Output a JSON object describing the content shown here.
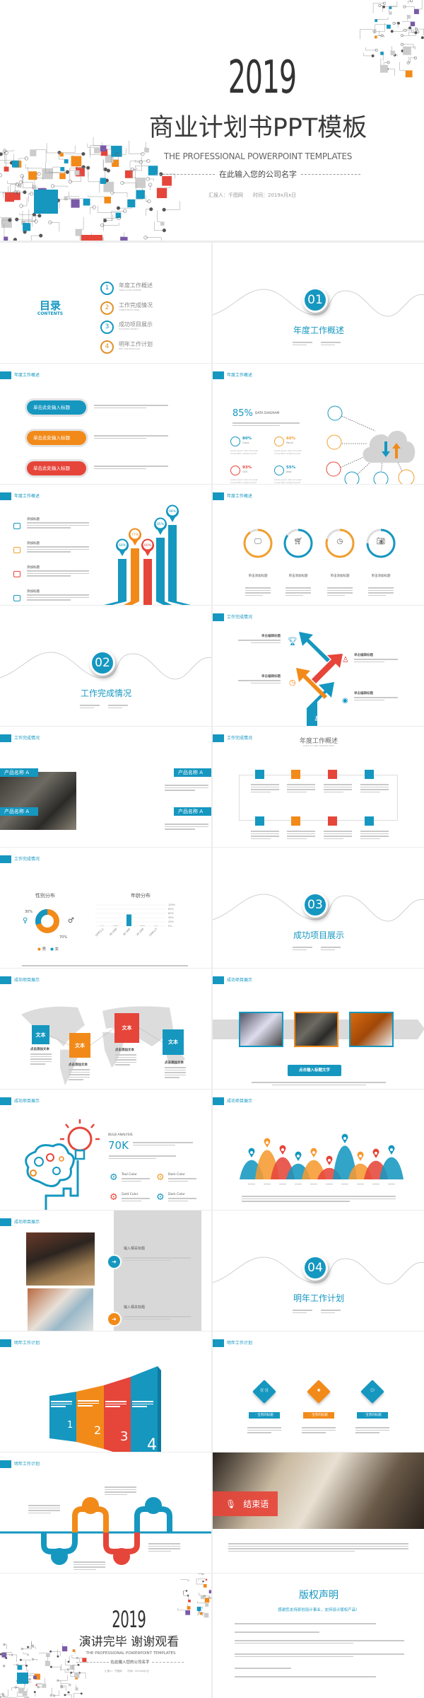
{
  "colors": {
    "teal": "#1597c0",
    "orange": "#f28a1a",
    "red": "#e6453a",
    "grey": "#cccccc"
  },
  "cover": {
    "year": "2019",
    "title": "商业计划书PPT模板",
    "subtitle_en": "THE PROFESSIONAL POWERPOINT TEMPLATES",
    "company": "在此输入您的公司名字",
    "reporter": "汇报人：千图网",
    "date": "时间：2019x月x日"
  },
  "toc": {
    "title": "目录",
    "title_en": "CONTENTS",
    "items": [
      {
        "num": "1",
        "label": "年度工作概述",
        "label_en": "ANNUAL WORK SUMMARY",
        "color": "#1597c0"
      },
      {
        "num": "2",
        "label": "工作完成情况",
        "label_en": "COMPLETION OF WORK",
        "color": "#e0922a"
      },
      {
        "num": "3",
        "label": "成功项目展示",
        "label_en": "SUCCESSFUL PROJECT",
        "color": "#1597c0"
      },
      {
        "num": "4",
        "label": "明年工作计划",
        "label_en": "NEXT YEAR WORK PLAN",
        "color": "#e0922a"
      }
    ]
  },
  "sections": [
    {
      "num": "01",
      "title": "年度工作概述"
    },
    {
      "num": "02",
      "title": "工作完成情况"
    },
    {
      "num": "03",
      "title": "成功项目展示"
    },
    {
      "num": "04",
      "title": "明年工作计划"
    }
  ],
  "headers": {
    "s1": "年度工作概述",
    "s2": "工作完成情况",
    "s3": "成功项目展示",
    "s4": "明年工作计划"
  },
  "pills": {
    "items": [
      "单击此处输入标题",
      "单击此处输入标题",
      "单击此处输入标题"
    ]
  },
  "data_diagram": {
    "big": "85%",
    "title": "DATA DIAGRAM",
    "stats": [
      {
        "value": "80%",
        "label": "Clock",
        "icon": "clock-icon",
        "desc": "Lorem ipsum dolor sit amet consectetur adipiscing elit"
      },
      {
        "value": "60%",
        "label": "Pencil",
        "icon": "pencil-icon",
        "desc": "Lorem ipsum dolor sit amet consectetur adipiscing elit"
      },
      {
        "value": "93%",
        "label": "CEO",
        "icon": "ceo-icon",
        "desc": "Lorem ipsum dolor sit amet consectetur adipiscing elit"
      },
      {
        "value": "55%",
        "label": "Idea",
        "icon": "bulb-icon",
        "desc": "Lorem ipsum dolor sit amet consectetur adipiscing elit"
      }
    ]
  },
  "bars_slide": {
    "items": [
      "添加标题",
      "添加标题",
      "添加标题",
      "添加标题"
    ],
    "pins": [
      "60%",
      "77%",
      "60%",
      "85%",
      "98%"
    ]
  },
  "rings": {
    "items": [
      {
        "label": "单击添加标题",
        "icon": "monitor-icon",
        "percent": 90,
        "color": "#f0a030"
      },
      {
        "label": "单击添加标题",
        "icon": "cart-icon",
        "percent": 85,
        "color": "#1597c0"
      },
      {
        "label": "单击添加标题",
        "icon": "clock-icon",
        "percent": 80,
        "color": "#f0a030"
      },
      {
        "label": "单击添加标题",
        "icon": "camera-icon",
        "percent": 75,
        "color": "#1597c0"
      }
    ]
  },
  "arrows": {
    "label": "单击编辑标题",
    "nums": [
      "01",
      "02",
      "03",
      "04"
    ]
  },
  "products": {
    "label": "产品名称 A"
  },
  "loop": {
    "title": "年度工作概述",
    "subtitle": "CLICK TO ADD CAPTION TEXT"
  },
  "gender": {
    "title": "性别分布",
    "female_pct": "30%",
    "male_pct": "70%",
    "male": "男",
    "female": "女",
    "male_value": 70,
    "female_value": 30
  },
  "age": {
    "title": "年龄分布",
    "categories": [
      "50岁以上",
      "40-49岁",
      "30-39岁",
      "20-29岁",
      "19岁以下"
    ],
    "values": [
      1,
      3,
      55,
      3,
      1
    ],
    "ticks": [
      "100%",
      "80%",
      "60%",
      "40%",
      "20%",
      "0%"
    ]
  },
  "map": {
    "box": "文本",
    "caption": "点击添加文本"
  },
  "photos_row": {
    "button": "点击输入标题文字"
  },
  "bulb": {
    "title": "BULB ANALYSIS",
    "big": "70K",
    "items": [
      "Teal Color",
      "Dark Color",
      "Gold Color",
      "Dark Color"
    ]
  },
  "hills": {
    "values": [
      27,
      41,
      31,
      22,
      27,
      16,
      47,
      22,
      26,
      31
    ]
  },
  "panel": {
    "items": [
      "输入相关标题",
      "输入相关标题"
    ]
  },
  "blocks": {
    "nums": [
      "1",
      "2",
      "3",
      "4"
    ]
  },
  "diamonds": {
    "label": "- 宝贵的标题",
    "icons": [
      "wifi-icon",
      "gear-icon",
      "chat-icon"
    ]
  },
  "ending": {
    "label": "结束语"
  },
  "closing": {
    "year": "2019",
    "title": "演讲完毕 谢谢观看",
    "subtitle_en": "THE PROFESSIONAL POWERPOINT TEMPLATES",
    "company": "在此输入您的公司名字",
    "reporter": "汇报人：千图网",
    "date": "时间：2019x月x日"
  },
  "copyright": {
    "title": "版权声明",
    "subtitle": "感谢您支持原创设计事业，支持设计版权产品！"
  }
}
